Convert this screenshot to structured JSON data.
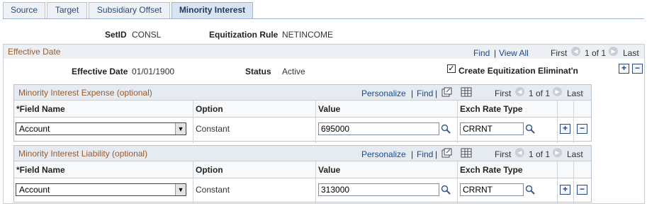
{
  "tabs": [
    {
      "label": "Source"
    },
    {
      "label": "Target"
    },
    {
      "label": "Subsidiary Offset"
    },
    {
      "label": "Minority Interest"
    }
  ],
  "header": {
    "setid_label": "SetID",
    "setid_value": "CONSL",
    "rule_label": "Equitization Rule",
    "rule_value": "NETINCOME"
  },
  "effective": {
    "title": "Effective Date",
    "find": "Find",
    "sep": "|",
    "view_all": "View All",
    "first": "First",
    "page_info": "1 of 1",
    "last": "Last",
    "date_label": "Effective Date",
    "date_value": "01/01/1900",
    "status_label": "Status",
    "status_value": "Active",
    "create_label": "Create Equitization Eliminat'n",
    "create_checked": "✓"
  },
  "grids": [
    {
      "title": "Minority Interest Expense (optional)",
      "personalize": "Personalize",
      "sep": "|",
      "find": "Find",
      "first": "First",
      "page_info": "1 of 1",
      "last": "Last",
      "columns": [
        "*Field Name",
        "Option",
        "Value",
        "Exch Rate Type"
      ],
      "row": {
        "field": "Account",
        "option": "Constant",
        "value": "695000",
        "rate": "CRRNT"
      }
    },
    {
      "title": "Minority Interest Liability (optional)",
      "personalize": "Personalize",
      "sep": "|",
      "find": "Find",
      "first": "First",
      "page_info": "1 of 1",
      "last": "Last",
      "columns": [
        "*Field Name",
        "Option",
        "Value",
        "Exch Rate Type"
      ],
      "row": {
        "field": "Account",
        "option": "Constant",
        "value": "313000",
        "rate": "CRRNT"
      }
    }
  ],
  "icons": {
    "add": "+",
    "remove": "−",
    "prev": "◀",
    "next": "▶",
    "dropdown": "▼"
  },
  "colors": {
    "tab_text": "#2b4a73",
    "section_title": "#9c5a2b",
    "link": "#1a4a8c"
  }
}
